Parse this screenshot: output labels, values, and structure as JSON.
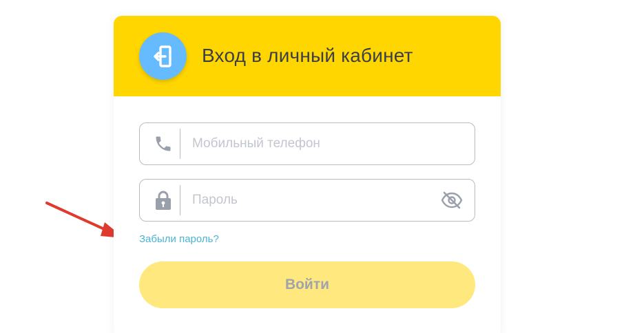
{
  "header": {
    "title": "Вход в личный кабинет",
    "icon": "login-door-icon",
    "background": "#FFD600",
    "avatar_color": "#66BBFF"
  },
  "form": {
    "phone": {
      "placeholder": "Мобильный телефон",
      "value": "",
      "icon": "phone-icon"
    },
    "password": {
      "placeholder": "Пароль",
      "value": "",
      "icon": "lock-icon",
      "toggle_icon": "eye-off-icon"
    },
    "forgot_link": "Забыли пароль?",
    "submit_label": "Войти"
  },
  "annotation": {
    "arrow_color": "#E03A2F"
  }
}
